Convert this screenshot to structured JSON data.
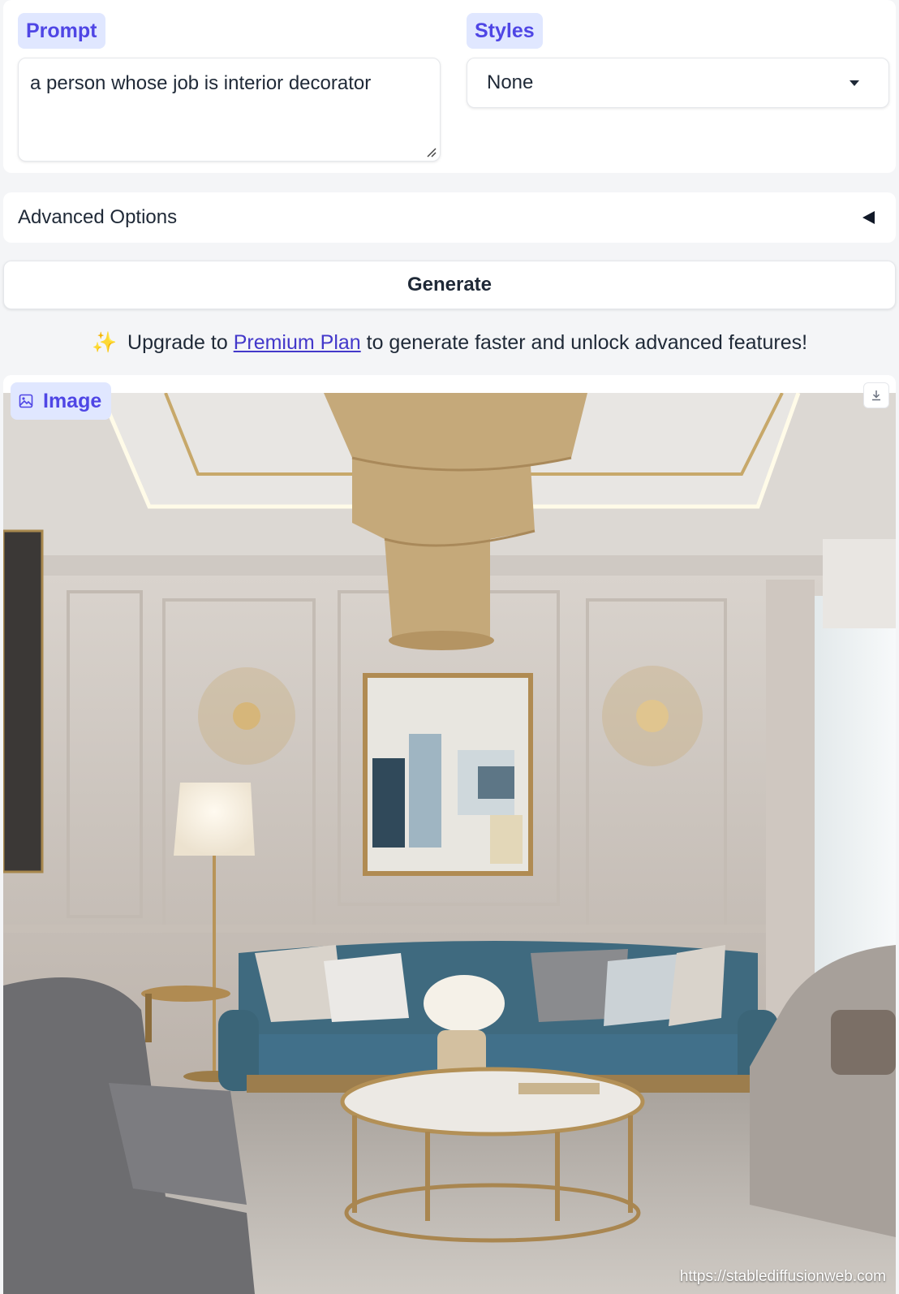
{
  "prompt": {
    "label": "Prompt",
    "value": "a person whose job is interior decorator"
  },
  "styles": {
    "label": "Styles",
    "selected": "None"
  },
  "advanced": {
    "label": "Advanced Options"
  },
  "generate": {
    "label": "Generate"
  },
  "upgrade": {
    "emoji": "✨",
    "before": "Upgrade to",
    "link": "Premium Plan",
    "after": "to generate faster and unlock advanced features!"
  },
  "output": {
    "label": "Image",
    "watermark": "https://stablediffusionweb.com"
  },
  "colors": {
    "accent": "#4f46e5",
    "badge_bg": "#e0e7ff",
    "link": "#4338ca"
  },
  "icons": {
    "image": "image-icon",
    "download": "download-icon",
    "dropdown": "caret-down-icon",
    "accordion": "triangle-left-icon"
  }
}
